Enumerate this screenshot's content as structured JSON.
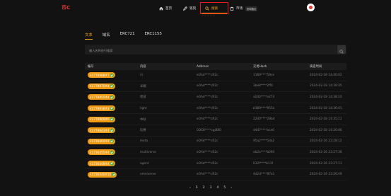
{
  "logo": {
    "text": "币C"
  },
  "nav": {
    "home": "首页",
    "mint": "铭刻",
    "search": "搜索",
    "market": "市场",
    "market_badge": "即将推出",
    "highlight_caption": "— — — — —"
  },
  "tabs": [
    "文本",
    "域名",
    "ERC721",
    "ERC1155"
  ],
  "search": {
    "placeholder": "输入名称进行搜索"
  },
  "table": {
    "headers": [
      "编号",
      "内容",
      "Address",
      "交易Hash",
      "铸造时间"
    ],
    "rows": [
      {
        "id": "41778988#7",
        "content": "川",
        "address": "eOhd****cR2c",
        "hash": "1169****59ce",
        "time": "2024-02-18 14:40:02"
      },
      {
        "id": "41778975#4",
        "content": "米糊",
        "address": "eOhd****cR2c",
        "hash": "3be8****2ff0",
        "time": "2024-02-18 14:39:35"
      },
      {
        "id": "41778955#4",
        "content": "地狱",
        "address": "eOhd****cR2c",
        "hash": "a240****e273",
        "time": "2024-02-18 14:38:10"
      },
      {
        "id": "41778916#3",
        "content": "light",
        "address": "eOhd****cR2c",
        "hash": "b389****955a",
        "time": "2024-02-18 14:36:01"
      },
      {
        "id": "41778909#6",
        "content": "中秋",
        "address": "eOhd****cR2c",
        "hash": "2240****28bd",
        "time": "2024-02-18 14:35:11"
      },
      {
        "id": "41778643#4",
        "content": "比赛",
        "address": "0DC8****cgj880",
        "hash": "d447****ace6",
        "time": "2024-02-18 14:20:06"
      },
      {
        "id": "41736464#4",
        "content": "meta",
        "address": "eOhd****cR2c",
        "hash": "95a2****5da2",
        "time": "2024-02-16 23:28:12"
      },
      {
        "id": "41736455#4",
        "content": "multiverse",
        "address": "eOhd****cR2c",
        "hash": "eb2a****b094",
        "time": "2024-02-16 23:27:36"
      },
      {
        "id": "41736448#4",
        "content": "agent",
        "address": "eOhd****cR2c",
        "hash": "632f****b11f",
        "time": "2024-02-16 23:27:11"
      },
      {
        "id": "41736440#10",
        "content": "omniverse",
        "address": "eOhd****cR2c",
        "hash": "4d2d****87a1",
        "time": "2024-02-16 23:26:49"
      }
    ]
  },
  "pagination": {
    "prev": "‹",
    "pages": [
      "1",
      "2",
      "3",
      "4",
      "5"
    ],
    "next": "›",
    "current": "1"
  }
}
